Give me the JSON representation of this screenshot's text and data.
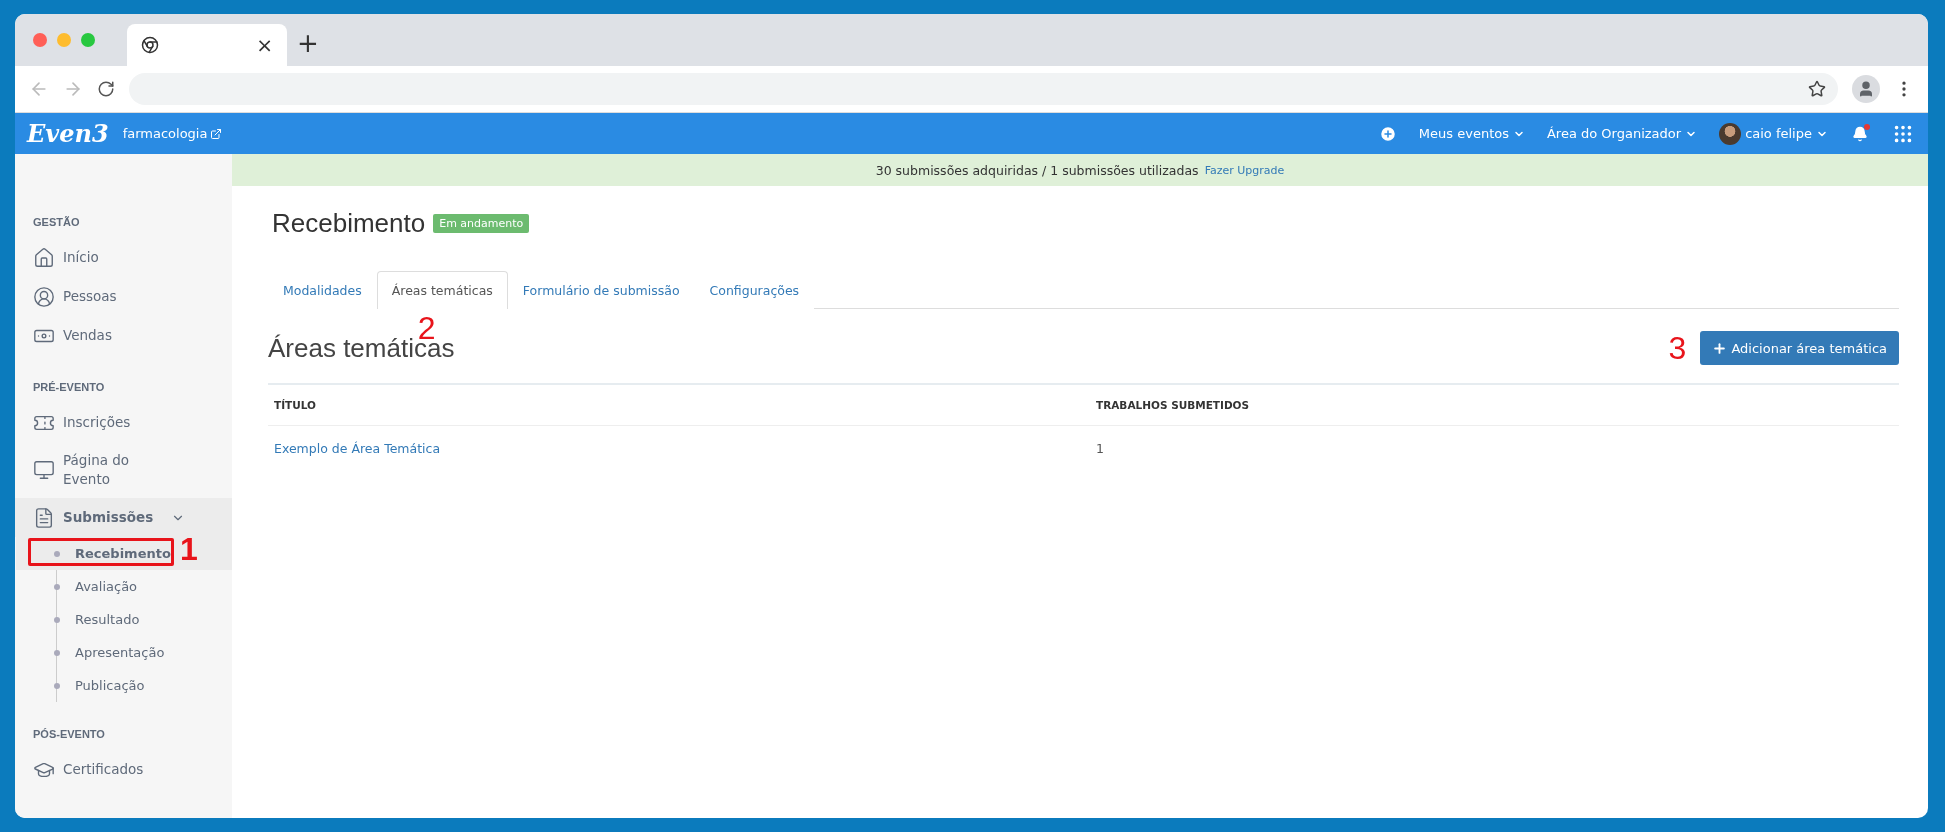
{
  "browser": {
    "tab_close": "×",
    "new_tab": "+"
  },
  "app_bar": {
    "logo": "Even3",
    "event": "farmacologia",
    "menus": [
      {
        "label": "Meus eventos",
        "kind": "menu"
      },
      {
        "label": "Área do Organizador",
        "kind": "menu"
      },
      {
        "label": "caio felipe",
        "kind": "user"
      }
    ],
    "notification": true
  },
  "banner": {
    "text": "30 submissões adquiridas / 1 submissões utilizadas",
    "link": "Fazer Upgrade"
  },
  "sidebar": {
    "sections": [
      {
        "title": "GESTÃO",
        "items": [
          {
            "label": "Início",
            "kind": "home"
          },
          {
            "label": "Pessoas",
            "kind": "person"
          },
          {
            "label": "Vendas",
            "kind": "money"
          }
        ]
      },
      {
        "title": "PRÉ-EVENTO",
        "items": [
          {
            "label": "Inscrições",
            "kind": "ticket"
          },
          {
            "label": "Página do Evento",
            "kind": "monitor"
          },
          {
            "label": "Submissões",
            "kind": "document",
            "expanded": true,
            "children": [
              {
                "label": "Recebimento",
                "selected": true,
                "annotation": "1"
              },
              {
                "label": "Avaliação",
                "selected": false
              },
              {
                "label": "Resultado",
                "selected": false
              },
              {
                "label": "Apresentação",
                "selected": false
              },
              {
                "label": "Publicação",
                "selected": false
              }
            ]
          }
        ]
      },
      {
        "title": "PÓS-EVENTO",
        "items": [
          {
            "label": "Certificados",
            "kind": "cap"
          }
        ]
      }
    ]
  },
  "page": {
    "title": "Recebimento",
    "status": "Em andamento",
    "tabs": [
      {
        "label": "Modalidades",
        "selected": false
      },
      {
        "label": "Áreas temáticas",
        "selected": true,
        "annotation": "2"
      },
      {
        "label": "Formulário de submissão",
        "selected": false
      },
      {
        "label": "Configurações",
        "selected": false
      }
    ],
    "heading": "Áreas temáticas",
    "add_button": {
      "label": "Adicionar área temática",
      "annotation": "3"
    },
    "table": {
      "columns": [
        "TÍTULO",
        "TRABALHOS SUBMETIDOS"
      ],
      "rows": [
        {
          "cells": [
            "Exemplo de Área Temática",
            "1"
          ]
        }
      ]
    }
  }
}
